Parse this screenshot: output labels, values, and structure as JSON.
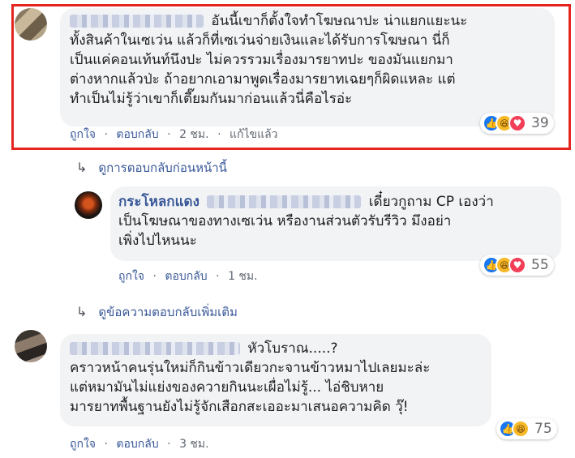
{
  "comments": [
    {
      "text_lines": [
        "อันนี้เขาก็ตั้งใจทำโฆษณาปะ น่าแยกแยะนะ",
        "ทั้งสินค้าในเซเว่น แล้วก็ที่เซเว่นจ่ายเงินและได้รับการโฆษณา นี่ก็",
        "เป็นแค่คอนเท้นท์นึงปะ ไม่ควรรวมเรื่องมารยาทปะ ของมันแยกมา",
        "ต่างหากแล้วป่ะ ถ้าอยากเอามาพูดเรื่องมารยาทเฉยๆก็ผิดแหละ แต่",
        "ทำเป็นไม่รู้ว่าเขาก็เตี๊ยมกันมาก่อนแล้วนี่คือไรอ่ะ"
      ],
      "like_label": "ถูกใจ",
      "reply_label": "ตอบกลับ",
      "time": "2 ชม.",
      "edited_label": "แก้ไขแล้ว",
      "reaction_count": "39",
      "reactions": [
        "like-icon",
        "haha-icon",
        "love-icon"
      ]
    },
    {
      "name": "กระโหลกแดง",
      "text_lines": [
        "เดี๋ยวกูถาม CP เองว่า",
        "เป็นโฆษณาของทางเซเว่น หรืองานส่วนตัวรับรีวิว มึงอย่า",
        "เพิ่งไปไหนนะ"
      ],
      "like_label": "ถูกใจ",
      "reply_label": "ตอบกลับ",
      "time": "1 ชม.",
      "reaction_count": "55",
      "reactions": [
        "like-icon",
        "haha-icon",
        "love-icon"
      ]
    },
    {
      "text_lines": [
        "หัวโบราณ.....?",
        "คราวหน้าคนรุ่นใหม่ก็กินข้าวเดียวกะจานข้าวหมาไปเลยมะล่ะ",
        "แต่หมามันไม่แย่งของควายกินนะเผื่อไม่รู้...  ไอ่ชิบหาย",
        "มารยาทพื้นฐานยังไม่รู้จักเสือกสะเออะมาเสนอความคิด วุ๊!"
      ],
      "like_label": "ถูกใจ",
      "reply_label": "ตอบกลับ",
      "time": "3 ชม.",
      "reaction_count": "75",
      "reactions": [
        "like-icon",
        "haha-icon"
      ]
    }
  ],
  "reply_links": {
    "previous_replies": "ดูการตอบกลับก่อนหน้านี้",
    "more_replies": "ดูข้อความตอบกลับเพิ่มเติม"
  },
  "separator": "·",
  "colors": {
    "highlight": "#e52620",
    "link": "#385898",
    "bubble": "#f2f3f5"
  }
}
